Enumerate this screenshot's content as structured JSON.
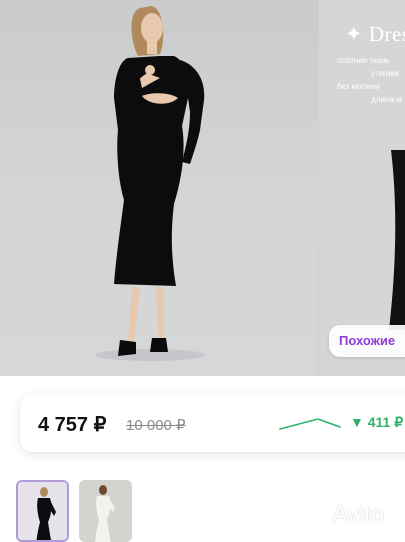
{
  "gallery": {
    "promo": {
      "title": "✦ Dres",
      "lines": [
        "плотная ткань",
        "утягива",
        "без молнии",
        "длина-м"
      ]
    },
    "similar_label": "Похожие"
  },
  "price": {
    "current": "4 757 ₽",
    "old": "10 000 ₽",
    "drop": "▼ 411 ₽",
    "drop_color": "#2fb36b"
  },
  "thumbnails": [
    "dress-black-photo",
    "dress-white-photo"
  ],
  "watermark": {
    "text": "Avito"
  }
}
